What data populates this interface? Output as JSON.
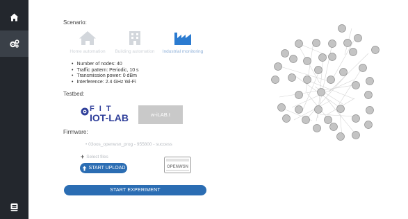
{
  "sidebar": {
    "icons": [
      "home-icon",
      "cogs-icon",
      "book-icon"
    ]
  },
  "scenario": {
    "label": "Scenario:",
    "options": [
      {
        "caption": "Home automation",
        "icon": "home-icon",
        "active": false
      },
      {
        "caption": "Building automation",
        "icon": "building-icon",
        "active": false
      },
      {
        "caption": "Industrial monitoring",
        "icon": "industry-icon",
        "active": true
      }
    ],
    "details": [
      "Number of nodes: 40",
      "Traffic pattern: Periodic, 10 s",
      "Transmission power: 0 dBm",
      "Interference: 2.4 GHz Wi-Fi"
    ]
  },
  "testbed": {
    "label": "Testbed:",
    "fit_logo_top": "F I T",
    "fit_logo_bottom": "IOT-LAB",
    "wilab_label": "w-iLAB.t"
  },
  "firmware": {
    "label": "Firmware:",
    "item": "03oos_openwsn_prog - 955800 - success",
    "select_files": "Select files",
    "upload_label": "START UPLOAD",
    "openwsn_logo_text": "OPENWSN"
  },
  "start_button": "START EXPERIMENT",
  "colors": {
    "sidebar_bg": "#23272d",
    "primary_blue": "#2b6db3",
    "active_icon": "#2b7bd0",
    "inactive_icon": "#d3d7dc",
    "node_fill": "#c4c4c4"
  }
}
